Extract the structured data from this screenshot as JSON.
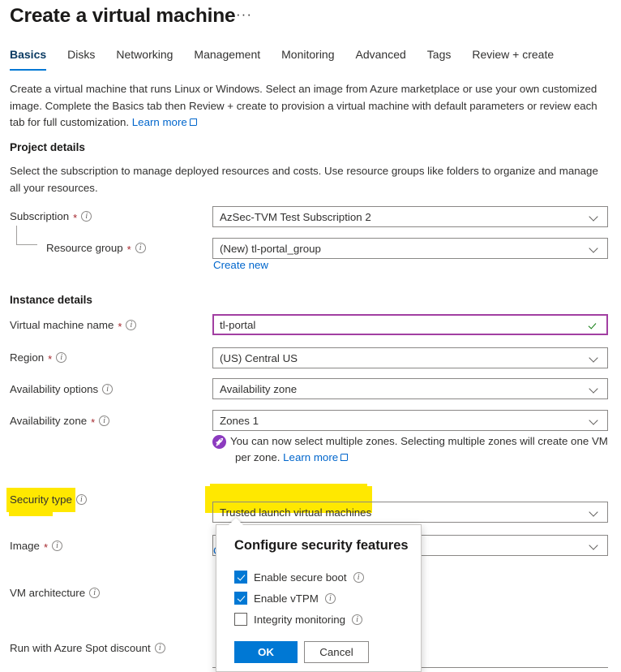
{
  "header": {
    "title": "Create a virtual machine",
    "ellipsis": "···"
  },
  "tabs": [
    {
      "label": "Basics",
      "active": true
    },
    {
      "label": "Disks",
      "active": false
    },
    {
      "label": "Networking",
      "active": false
    },
    {
      "label": "Management",
      "active": false
    },
    {
      "label": "Monitoring",
      "active": false
    },
    {
      "label": "Advanced",
      "active": false
    },
    {
      "label": "Tags",
      "active": false
    },
    {
      "label": "Review + create",
      "active": false
    }
  ],
  "intro": {
    "text": "Create a virtual machine that runs Linux or Windows. Select an image from Azure marketplace or use your own customized image. Complete the Basics tab then Review + create to provision a virtual machine with default parameters or review each tab for full customization.",
    "link": "Learn more"
  },
  "project_details": {
    "heading": "Project details",
    "description": "Select the subscription to manage deployed resources and costs. Use resource groups like folders to organize and manage all your resources.",
    "subscription": {
      "label": "Subscription",
      "required": "*",
      "value": "AzSec-TVM Test Subscription 2"
    },
    "resource_group": {
      "label": "Resource group",
      "required": "*",
      "value": "(New) tl-portal_group",
      "create_new": "Create new"
    }
  },
  "instance_details": {
    "heading": "Instance details",
    "vm_name": {
      "label": "Virtual machine name",
      "required": "*",
      "value": "tl-portal"
    },
    "region": {
      "label": "Region",
      "required": "*",
      "value": "(US) Central US"
    },
    "availability_options": {
      "label": "Availability options",
      "value": "Availability zone"
    },
    "availability_zone": {
      "label": "Availability zone",
      "required": "*",
      "value": "Zones 1",
      "hint_line1": "You can now select multiple zones. Selecting multiple zones will create one VM",
      "hint_line2": "per zone.",
      "hint_link": "Learn more"
    },
    "security_type": {
      "label": "Security type",
      "value": "Trusted launch virtual machines",
      "configure_link": "Configure security features"
    },
    "image": {
      "label": "Image",
      "required": "*",
      "value": ""
    },
    "vm_architecture": {
      "label": "VM architecture",
      "value": ""
    },
    "spot_discount": {
      "label": "Run with Azure Spot discount",
      "value": ""
    }
  },
  "popup": {
    "title": "Configure security features",
    "options": [
      {
        "label": "Enable secure boot",
        "checked": true
      },
      {
        "label": "Enable vTPM",
        "checked": true
      },
      {
        "label": "Integrity monitoring",
        "checked": false
      }
    ],
    "ok_label": "OK",
    "cancel_label": "Cancel"
  },
  "colors": {
    "accent": "#0078d4",
    "link": "#0066cc",
    "highlight": "#ffe800",
    "focus_border": "#a23fa2",
    "valid_check": "#107c10",
    "required_star": "#a4262c",
    "rocket_badge": "#8c3bbf"
  }
}
